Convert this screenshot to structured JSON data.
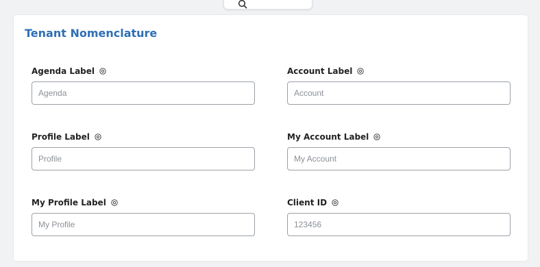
{
  "top_tab": {
    "icon": "search-icon"
  },
  "section": {
    "title": "Tenant Nomenclature",
    "accent_color": "#2f6fb5",
    "fields": [
      {
        "label": "Agenda Label",
        "placeholder": "Agenda",
        "value": "",
        "icon": "help-icon"
      },
      {
        "label": "Account Label",
        "placeholder": "Account",
        "value": "",
        "icon": "help-icon"
      },
      {
        "label": "Profile Label",
        "placeholder": "Profile",
        "value": "",
        "icon": "help-icon"
      },
      {
        "label": "My Account Label",
        "placeholder": "My Account",
        "value": "",
        "icon": "help-icon"
      },
      {
        "label": "My Profile Label",
        "placeholder": "My Profile",
        "value": "",
        "icon": "help-icon"
      },
      {
        "label": "Client ID",
        "placeholder": "123456",
        "value": "",
        "icon": "help-icon"
      }
    ]
  }
}
